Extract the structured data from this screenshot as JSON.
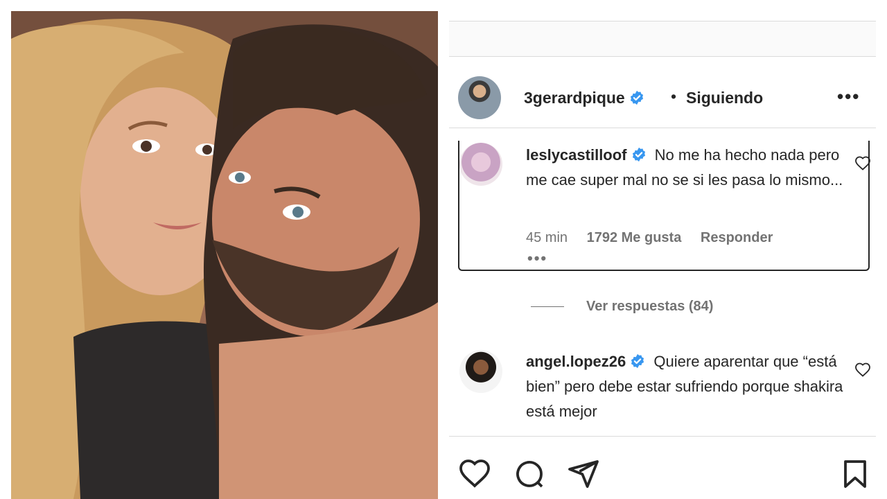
{
  "post": {
    "username": "3gerardpique",
    "separator": "•",
    "follow_label": "Siguiendo",
    "more_label": "•••"
  },
  "comments": [
    {
      "username": "leslycastilloof",
      "text": "No me ha hecho nada pero me cae super mal no se si les pasa lo mismo...",
      "time": "45 min",
      "likes": "1792 Me gusta",
      "reply_label": "Responder",
      "more_label": "•••",
      "verified": true
    },
    {
      "username": "angel.lopez26",
      "text": "Quiere aparentar que “está bien” pero debe estar sufriendo porque shakira está mejor",
      "verified": true
    }
  ],
  "replies": {
    "label": "Ver respuestas (84)"
  },
  "icons": {
    "like": "heart-icon",
    "comment": "comment-icon",
    "share": "send-icon",
    "save": "bookmark-icon",
    "verified": "verified-badge-icon"
  },
  "colors": {
    "verified_blue": "#3897f0",
    "text": "#262626",
    "secondary": "#737373"
  }
}
